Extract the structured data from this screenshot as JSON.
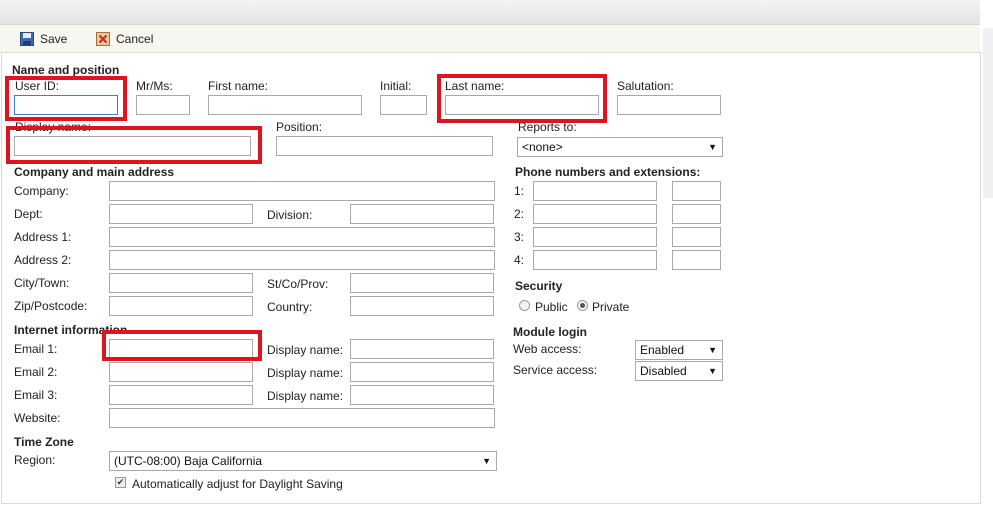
{
  "toolbar": {
    "save_label": "Save",
    "cancel_label": "Cancel"
  },
  "name_section": {
    "title": "Name and position",
    "user_id": "User ID:",
    "mr_ms": "Mr/Ms:",
    "first_name": "First name:",
    "initial": "Initial:",
    "last_name": "Last name:",
    "salutation": "Salutation:",
    "display_name": "Display name:",
    "position": "Position:",
    "reports_to": "Reports to:",
    "reports_to_value": "<none>"
  },
  "company_section": {
    "title": "Company and main address",
    "company": "Company:",
    "dept": "Dept:",
    "division": "Division:",
    "address1": "Address 1:",
    "address2": "Address 2:",
    "city": "City/Town:",
    "state": "St/Co/Prov:",
    "zip": "Zip/Postcode:",
    "country": "Country:"
  },
  "phone_section": {
    "title": "Phone numbers and extensions:",
    "rows": [
      "1:",
      "2:",
      "3:",
      "4:"
    ]
  },
  "security_section": {
    "title": "Security",
    "public": "Public",
    "private": "Private",
    "selected": "Private"
  },
  "internet_section": {
    "title": "Internet information",
    "email1": "Email 1:",
    "email2": "Email 2:",
    "email3": "Email 3:",
    "display_name": "Display name:",
    "website": "Website:"
  },
  "module_section": {
    "title": "Module login",
    "web_access": "Web access:",
    "web_access_value": "Enabled",
    "service_access": "Service access:",
    "service_access_value": "Disabled"
  },
  "timezone_section": {
    "title": "Time Zone",
    "region": "Region:",
    "region_value": "(UTC-08:00) Baja California",
    "daylight_label": "Automatically adjust for Daylight Saving",
    "daylight_checked": true
  },
  "colors": {
    "highlight": "#e0141e",
    "focus_border": "#4a79c7"
  }
}
